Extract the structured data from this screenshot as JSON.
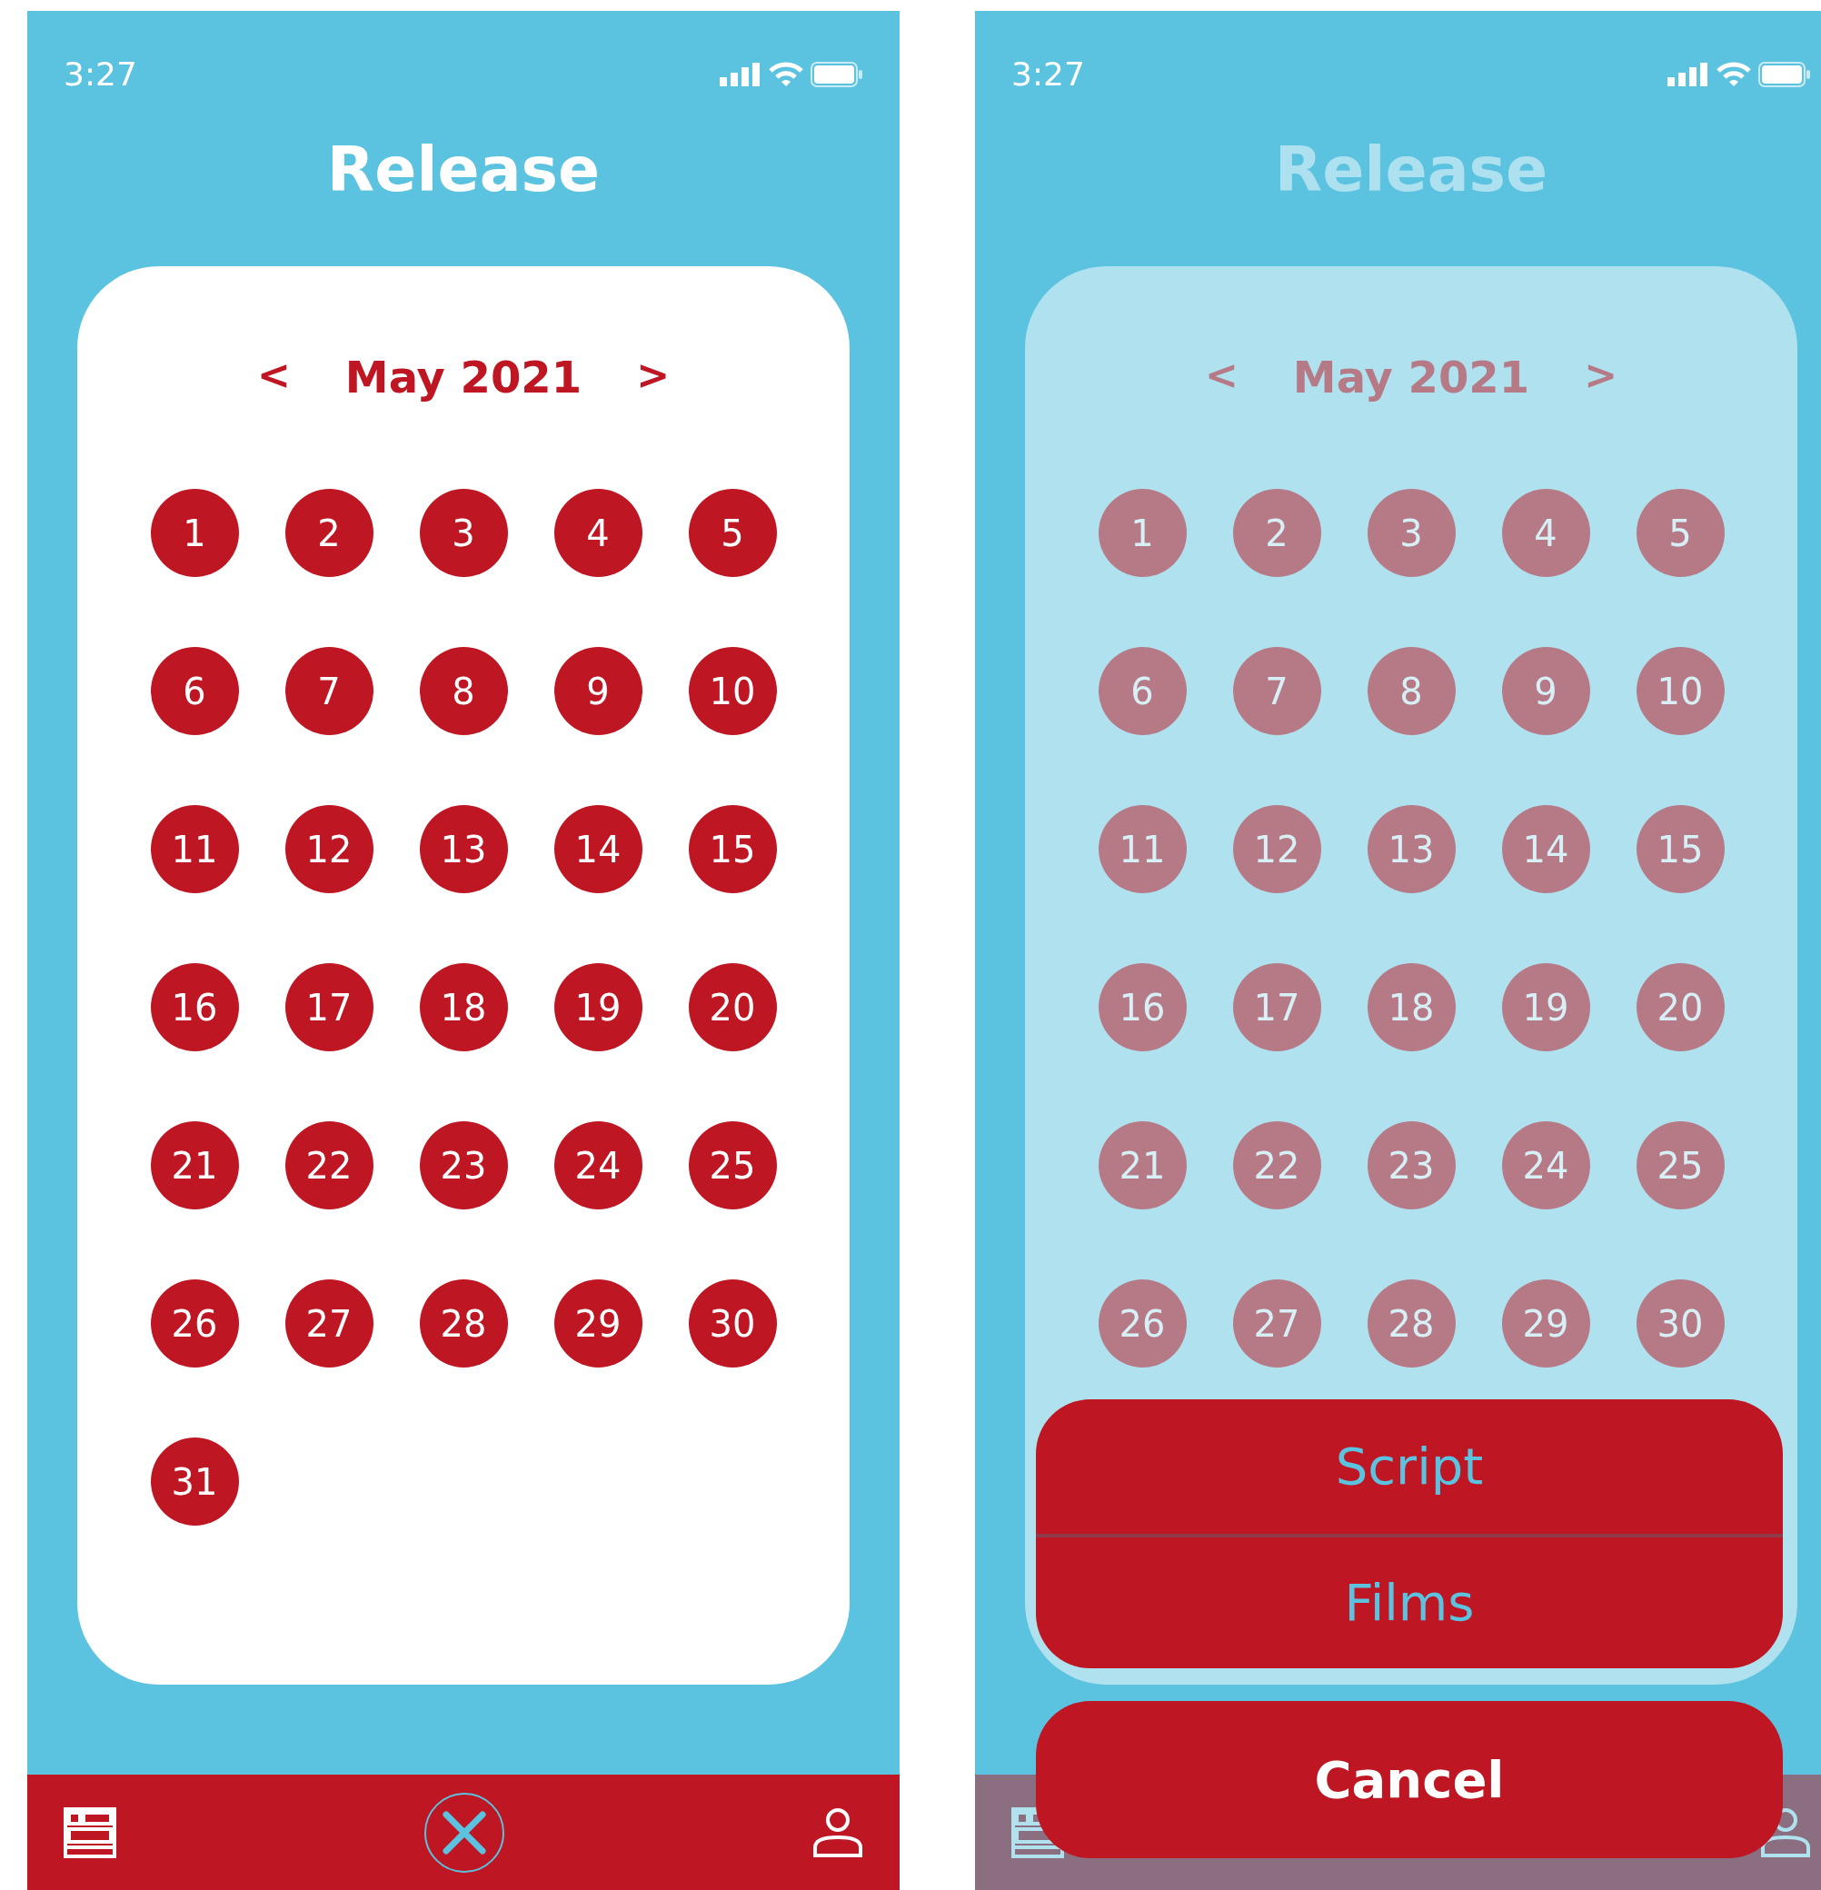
{
  "screens": [
    {
      "status_bar": {
        "time": "3:27"
      },
      "title": "Release",
      "dimmed": false,
      "calendar": {
        "prev": "<",
        "month": "May 2021",
        "next": ">",
        "days": [
          "1",
          "2",
          "3",
          "4",
          "5",
          "6",
          "7",
          "8",
          "9",
          "10",
          "11",
          "12",
          "13",
          "14",
          "15",
          "16",
          "17",
          "18",
          "19",
          "20",
          "21",
          "22",
          "23",
          "24",
          "25",
          "26",
          "27",
          "28",
          "29",
          "30",
          "31"
        ]
      }
    },
    {
      "status_bar": {
        "time": "3:27"
      },
      "title": "Release",
      "dimmed": true,
      "calendar": {
        "prev": "<",
        "month": "May 2021",
        "next": ">",
        "days": [
          "1",
          "2",
          "3",
          "4",
          "5",
          "6",
          "7",
          "8",
          "9",
          "10",
          "11",
          "12",
          "13",
          "14",
          "15",
          "16",
          "17",
          "18",
          "19",
          "20",
          "21",
          "22",
          "23",
          "24",
          "25",
          "26",
          "27",
          "28",
          "29",
          "30"
        ]
      },
      "action_sheet": {
        "options": [
          "Script",
          "Films"
        ],
        "cancel": "Cancel"
      }
    }
  ]
}
